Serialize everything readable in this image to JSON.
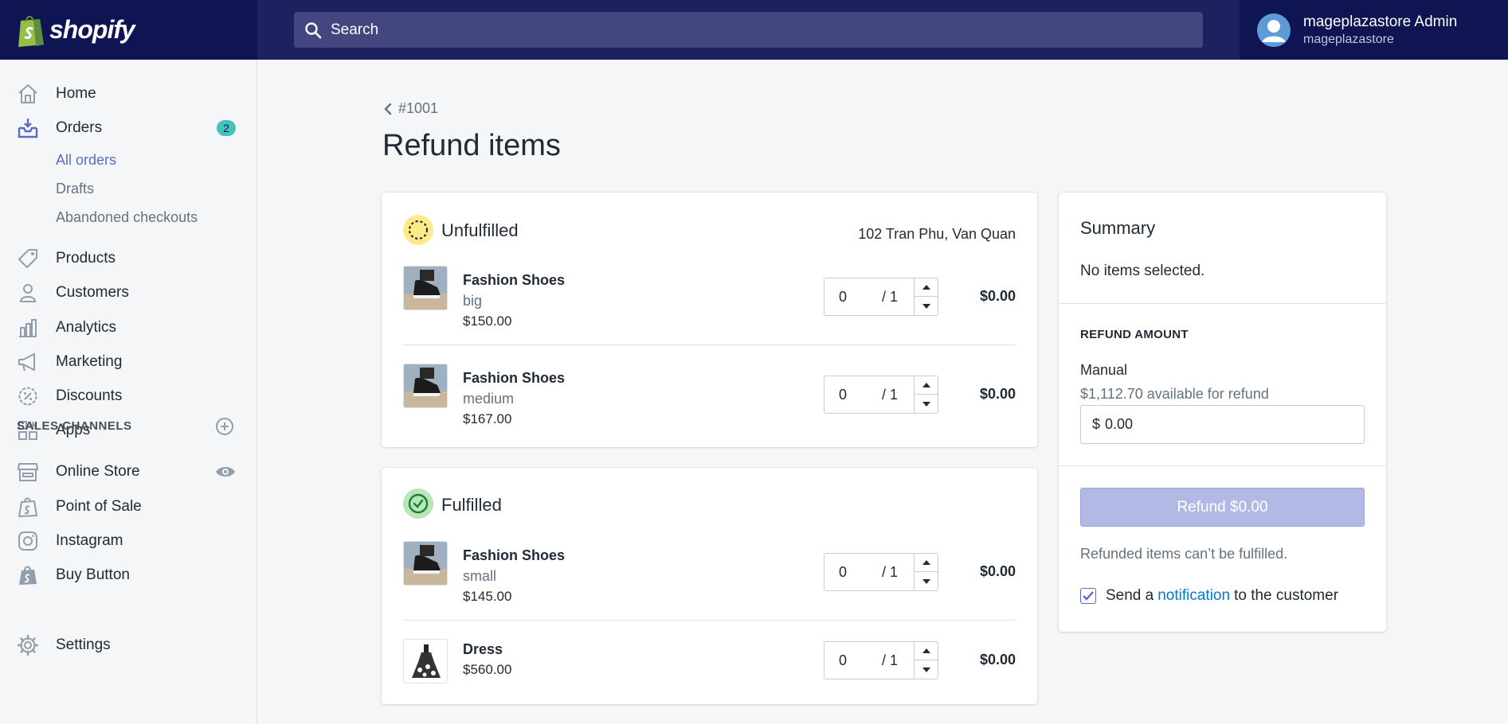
{
  "brand": {
    "name": "shopify"
  },
  "search": {
    "placeholder": "Search"
  },
  "user": {
    "name": "mageplazastore Admin",
    "store": "mageplazastore"
  },
  "sidebar": {
    "items": [
      {
        "label": "Home",
        "icon": "home-icon"
      },
      {
        "label": "Orders",
        "icon": "orders-icon",
        "badge": "2"
      },
      {
        "label": "Products",
        "icon": "tag-icon"
      },
      {
        "label": "Customers",
        "icon": "person-icon"
      },
      {
        "label": "Analytics",
        "icon": "bar-chart-icon"
      },
      {
        "label": "Marketing",
        "icon": "megaphone-icon"
      },
      {
        "label": "Discounts",
        "icon": "discount-icon"
      },
      {
        "label": "Apps",
        "icon": "apps-icon"
      }
    ],
    "order_sub": [
      "All orders",
      "Drafts",
      "Abandoned checkouts"
    ],
    "channels_label": "SALES CHANNELS",
    "channels": [
      {
        "label": "Online Store",
        "icon": "store-icon"
      },
      {
        "label": "Point of Sale",
        "icon": "pos-icon"
      },
      {
        "label": "Instagram",
        "icon": "instagram-icon"
      },
      {
        "label": "Buy Button",
        "icon": "buy-button-icon"
      }
    ],
    "settings": {
      "label": "Settings",
      "icon": "gear-icon"
    }
  },
  "page": {
    "back": "#1001",
    "title": "Refund items"
  },
  "unfulfilled": {
    "title": "Unfulfilled",
    "address": "102 Tran Phu, Van Quan",
    "items": [
      {
        "name": "Fashion Shoes",
        "variant": "big",
        "price": "$150.00",
        "qty": "0",
        "max": "/ 1",
        "total": "$0.00"
      },
      {
        "name": "Fashion Shoes",
        "variant": "medium",
        "price": "$167.00",
        "qty": "0",
        "max": "/ 1",
        "total": "$0.00"
      }
    ]
  },
  "fulfilled": {
    "title": "Fulfilled",
    "items": [
      {
        "name": "Fashion Shoes",
        "variant": "small",
        "price": "$145.00",
        "qty": "0",
        "max": "/ 1",
        "total": "$0.00"
      },
      {
        "name": "Dress",
        "variant": "",
        "price": "$560.00",
        "qty": "0",
        "max": "/ 1",
        "total": "$0.00"
      }
    ]
  },
  "summary": {
    "title": "Summary",
    "empty": "No items selected.",
    "refund_heading": "REFUND AMOUNT",
    "manual": "Manual",
    "available": "$1,112.70 available for refund",
    "currency": "$",
    "amount": "0.00",
    "button": "Refund $0.00",
    "note": "Refunded items can’t be fulfilled.",
    "notify_pre": "Send a",
    "notify_link": "notification",
    "notify_post": "to the customer",
    "notify_checked": true
  },
  "colors": {
    "topbar": "#1c2260",
    "accent": "#5c6ac4",
    "badge": "#47c1bf",
    "link": "#007ace"
  }
}
